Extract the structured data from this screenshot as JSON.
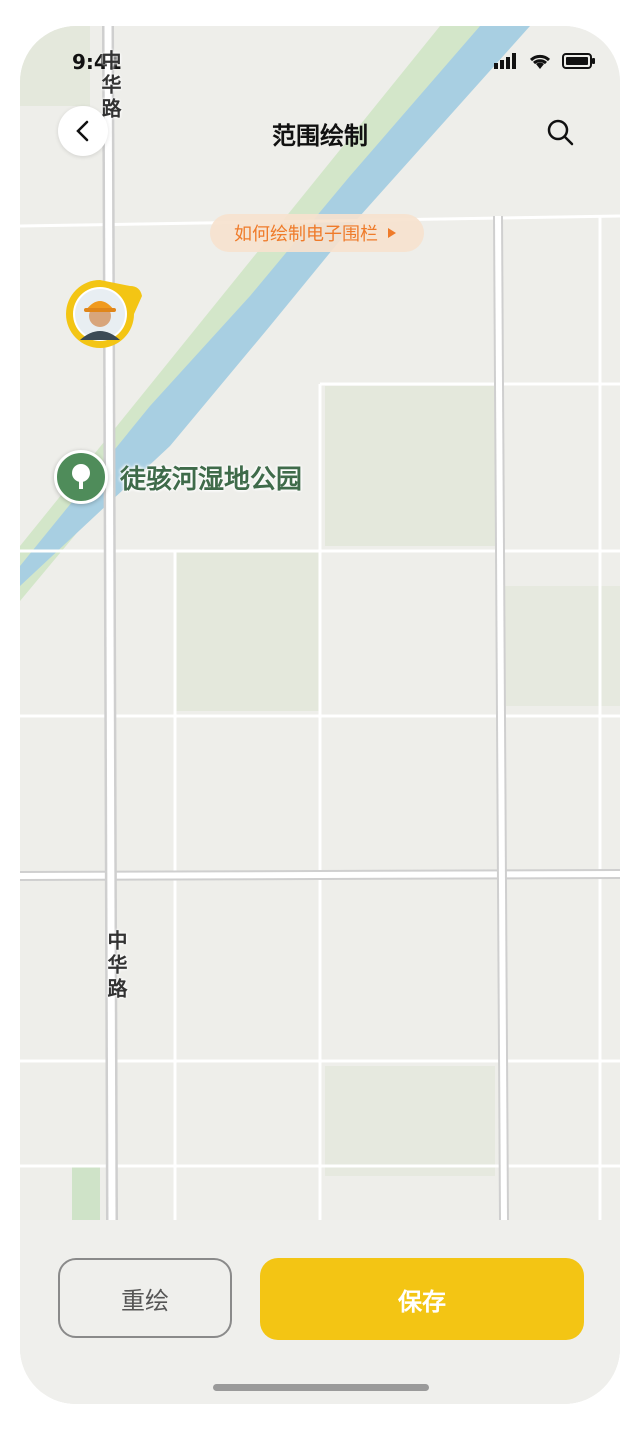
{
  "status_bar": {
    "time": "9:41"
  },
  "nav": {
    "title": "范围绘制"
  },
  "hint": {
    "label": "如何绘制电子围栏"
  },
  "map": {
    "park_label": "徒骇河湿地公园",
    "road_label_top": "中华路",
    "road_label_mid": "中华路"
  },
  "actions": {
    "redraw_label": "重绘",
    "save_label": "保存"
  },
  "colors": {
    "accent": "#f3c514",
    "hint_text": "#ef7b2a",
    "water": "#a8cfe2",
    "park_green": "#4f8c5a"
  },
  "icons": {
    "back": "chevron-left-icon",
    "search": "search-icon",
    "park": "tree-icon",
    "signal": "signal-icon",
    "wifi": "wifi-icon",
    "battery": "battery-icon"
  }
}
